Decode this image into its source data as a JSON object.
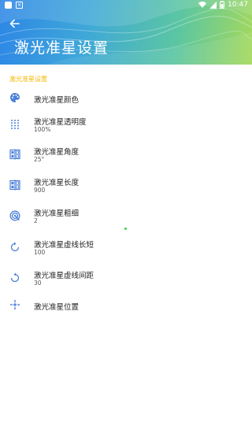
{
  "status": {
    "time": "10:47"
  },
  "header": {
    "title": "激光准星设置"
  },
  "section_title": "激光准星设置",
  "items": [
    {
      "label": "激光准星颜色",
      "value": "",
      "icon": "palette-icon"
    },
    {
      "label": "激光准星透明度",
      "value": "100%",
      "icon": "dots-grid-icon"
    },
    {
      "label": "激光准星角度",
      "value": "25°",
      "icon": "compare-icon"
    },
    {
      "label": "激光准星长度",
      "value": "900",
      "icon": "compare-icon"
    },
    {
      "label": "激光准星粗细",
      "value": "2",
      "icon": "target-icon"
    },
    {
      "label": "激光准星虚线长短",
      "value": "100",
      "icon": "rotate-icon"
    },
    {
      "label": "激光准星虚线间距",
      "value": "30",
      "icon": "rotate-icon"
    },
    {
      "label": "激光准星位置",
      "value": "",
      "icon": "crosshair-icon"
    }
  ],
  "colors": {
    "accent": "#4a7fd9",
    "section": "#f5b800"
  }
}
